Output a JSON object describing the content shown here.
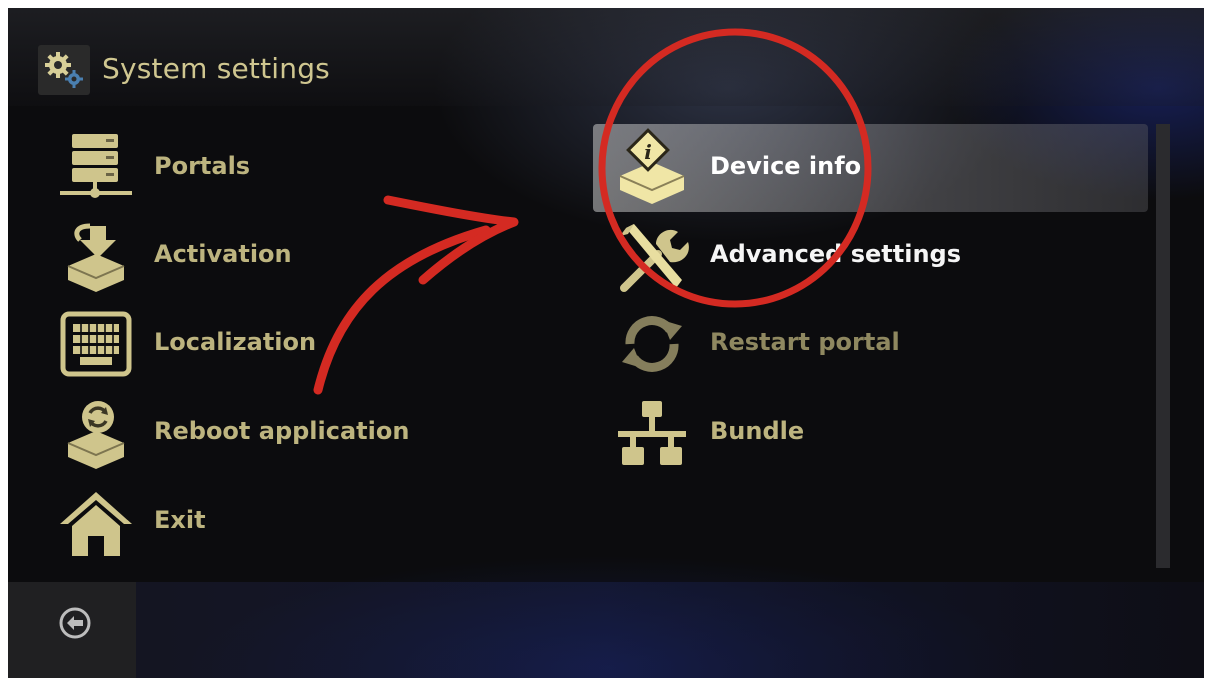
{
  "header": {
    "title": "System settings",
    "icon": "gears-icon"
  },
  "menu": {
    "left": [
      {
        "label": "Portals",
        "icon": "server-icon"
      },
      {
        "label": "Activation",
        "icon": "activation-box-icon"
      },
      {
        "label": "Localization",
        "icon": "keyboard-icon"
      },
      {
        "label": "Reboot application",
        "icon": "reboot-box-icon"
      },
      {
        "label": "Exit",
        "icon": "home-icon"
      }
    ],
    "right": [
      {
        "label": "Device info",
        "icon": "device-info-icon",
        "selected": true
      },
      {
        "label": "Advanced settings",
        "icon": "tools-icon"
      },
      {
        "label": "Restart portal",
        "icon": "restart-icon"
      },
      {
        "label": "Bundle",
        "icon": "network-icon"
      }
    ]
  },
  "footer": {
    "back_icon": "back-arrow-icon"
  },
  "colors": {
    "label": "#bdb47f",
    "icon": "#cfc58c",
    "highlight": "#ffffff",
    "annotation": "#d42a22"
  }
}
